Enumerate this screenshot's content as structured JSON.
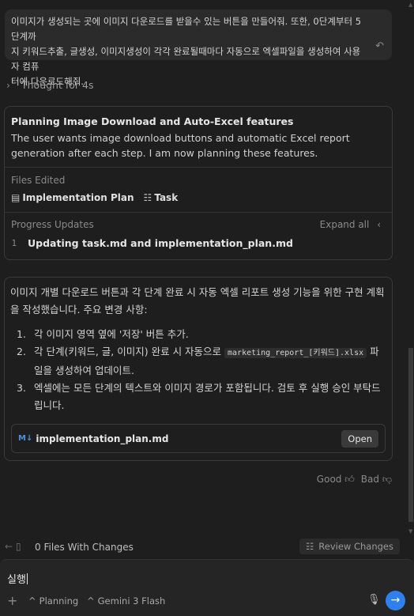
{
  "user_message": {
    "line1": "이미지가 생성되는 곳에 이미지 다운로드를 받을수 있는 버튼을 만들어줘. 또한, 0단계부터 5단계까",
    "line2": "지  키워드추출, 글생성, 이미지생성이 각각 완료될때마다 자동으로 엑셀파일을 생성하여 사용자 컴퓨",
    "line3": "터에 다운로드해줘."
  },
  "thought": {
    "label": "Thought for 4s"
  },
  "task_card": {
    "title": "Planning Image Download and Auto-Excel features",
    "description": "The user wants image download buttons and automatic Excel report generation after each step. I am now planning these features.",
    "files_edited_label": "Files Edited",
    "files": [
      "Implementation Plan",
      "Task"
    ],
    "progress_label": "Progress Updates",
    "expand_label": "Expand all",
    "progress_items": [
      {
        "num": "1",
        "text": "Updating task.md and implementation_plan.md"
      }
    ]
  },
  "response_card": {
    "intro": "이미지 개별 다운로드 버튼과 각 단계 완료 시 자동 엑셀 리포트 생성 기능을 위한 구현 계획을 작성했습니다. 주요 변경 사항:",
    "items": [
      {
        "num": "1.",
        "text": "각 이미지 영역 옆에 '저장' 버튼 추가."
      },
      {
        "num": "2.",
        "pre": "각 단계(키워드, 글, 이미지) 완료 시 자동으로 ",
        "code": "marketing_report_[키워드].xlsx",
        "post": " 파일을 생성하여 업데이트."
      },
      {
        "num": "3.",
        "text": "엑셀에는 모든 단계의 텍스트와 이미지 경로가 포함됩니다. 검토 후 실행 승인 부탁드립니다."
      }
    ],
    "artifact": {
      "icon": "M↓",
      "name": "implementation_plan.md",
      "open_label": "Open"
    }
  },
  "feedback": {
    "good": "Good",
    "bad": "Bad"
  },
  "files_bar": {
    "text": "0 Files With Changes",
    "review_label": "Review Changes"
  },
  "composer": {
    "value": "실행",
    "mode": "Planning",
    "model": "Gemini 3 Flash"
  },
  "icons": {
    "undo": "undo-icon",
    "thumb_up": "thumbs-up-icon",
    "thumb_down": "thumbs-down-icon",
    "mic": "microphone-icon",
    "send": "send-arrow-icon"
  },
  "colors": {
    "accent": "#2f80ed",
    "background": "#1e1e1e",
    "card_border": "#3a3a3a"
  }
}
